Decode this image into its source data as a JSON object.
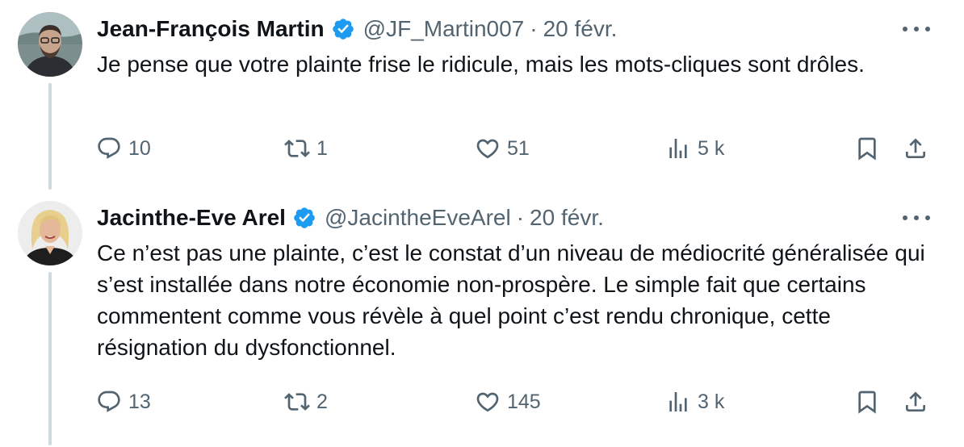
{
  "tweets": [
    {
      "name": "Jean-François Martin",
      "handle": "@JF_Martin007",
      "separator": "·",
      "date": "20 févr.",
      "text": "Je pense que votre plainte frise le ridicule, mais les mots-cliques sont drôles.",
      "replies": "10",
      "retweets": "1",
      "likes": "51",
      "views": "5 k"
    },
    {
      "name": "Jacinthe-Eve Arel",
      "handle": "@JacintheEveArel",
      "separator": "·",
      "date": "20 févr.",
      "text": "Ce n’est pas une plainte, c’est le constat d’un niveau de médiocrité généralisée qui s’est installée dans notre économie non-prospère. Le simple fait que certains commentent comme vous révèle à quel point c’est rendu chronique, cette résignation du dysfonctionnel.",
      "replies": "13",
      "retweets": "2",
      "likes": "145",
      "views": "3 k"
    }
  ],
  "colors": {
    "text": "#0f1419",
    "secondary": "#536471",
    "verified": "#1d9bf0",
    "thread_line": "#cfd9de"
  },
  "icons": [
    "verified-badge-icon",
    "more-icon",
    "reply-icon",
    "retweet-icon",
    "like-icon",
    "views-icon",
    "bookmark-icon",
    "share-icon"
  ]
}
